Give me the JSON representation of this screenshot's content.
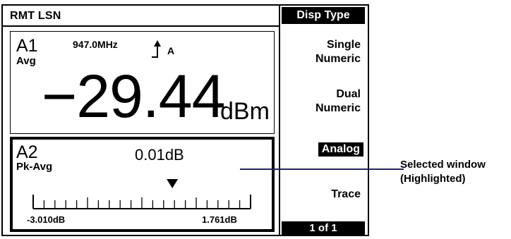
{
  "status_bar": {
    "text": "RMT LSN"
  },
  "menu": {
    "title": "Disp Type",
    "softkeys": [
      {
        "line1": "Single",
        "line2": "Numeric"
      },
      {
        "line1": "Dual",
        "line2": "Numeric"
      },
      {
        "label": "Analog",
        "selected": true
      },
      {
        "label": "Trace"
      }
    ],
    "page_indicator": "1 of 1"
  },
  "window_a1": {
    "id": "A1",
    "measurement": "Avg",
    "frequency": "947.0MHz",
    "trigger_icon": "trigger-rising-edge-icon",
    "trigger_label": "A",
    "value": "−29.44",
    "unit": "dBm"
  },
  "window_a2": {
    "id": "A2",
    "measurement": "Pk-Avg",
    "value": "0.01dB",
    "scale_min": "-3.010dB",
    "scale_max": "1.761dB",
    "pointer_fraction": 0.64
  },
  "callout": {
    "line1": "Selected window",
    "line2": "(Highlighted)"
  }
}
